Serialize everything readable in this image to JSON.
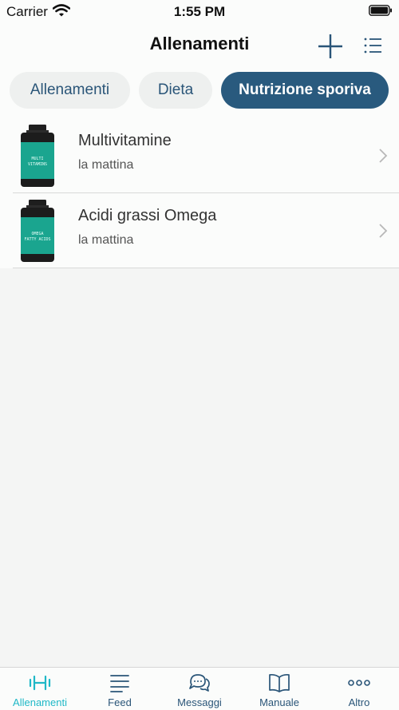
{
  "status_bar": {
    "carrier": "Carrier",
    "time": "1:55 PM"
  },
  "header": {
    "title": "Allenamenti",
    "add_icon": "plus-icon",
    "menu_icon": "list-icon"
  },
  "tabs": [
    {
      "label": "Allenamenti",
      "active": false
    },
    {
      "label": "Dieta",
      "active": false
    },
    {
      "label": "Nutrizione sporiva",
      "active": true
    }
  ],
  "items": [
    {
      "title": "Multivitamine",
      "subtitle": "la mattina",
      "label_line1": "MULTI",
      "label_line2": "VITAMINS"
    },
    {
      "title": "Acidi grassi Omega",
      "subtitle": "la mattina",
      "label_line1": "OMEGA",
      "label_line2": "FATTY ACIDS"
    }
  ],
  "tabbar": [
    {
      "label": "Allenamenti",
      "icon": "dumbbell-icon",
      "active": true
    },
    {
      "label": "Feed",
      "icon": "feed-lines-icon",
      "active": false
    },
    {
      "label": "Messaggi",
      "icon": "chat-bubbles-icon",
      "active": false
    },
    {
      "label": "Manuale",
      "icon": "book-icon",
      "active": false
    },
    {
      "label": "Altro",
      "icon": "more-dots-icon",
      "active": false
    }
  ],
  "colors": {
    "accent": "#295a7e",
    "active_tab": "#1fb8c7",
    "bottle_label": "#1aa58f"
  }
}
